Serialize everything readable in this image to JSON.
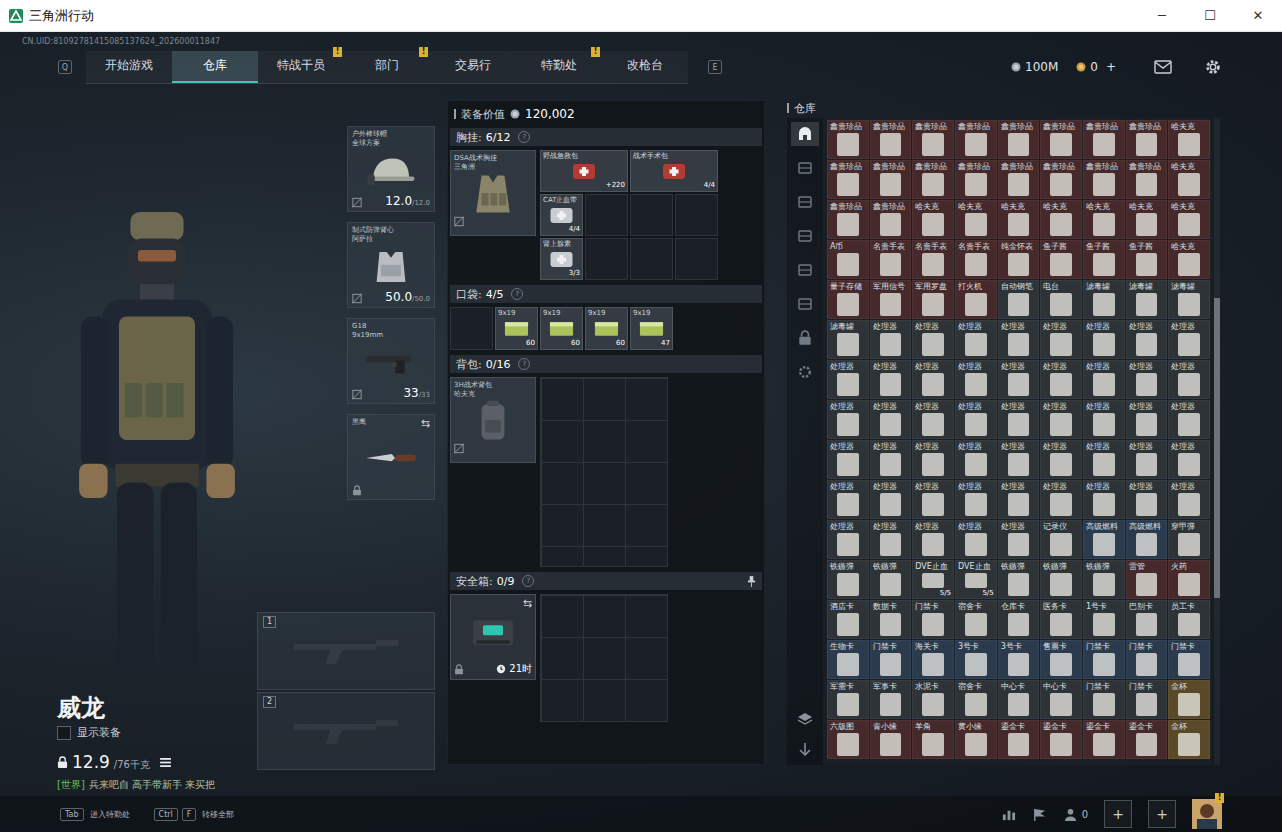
{
  "window": {
    "title": "三角洲行动",
    "controls": [
      "─",
      "☐",
      "✕"
    ]
  },
  "uid": "CN.UID:81092781415085137624_202600011847",
  "nav": {
    "left_key": "Q",
    "right_key": "E",
    "tabs": [
      {
        "label": "开始游戏",
        "selected": false,
        "badge": ""
      },
      {
        "label": "仓库",
        "selected": true,
        "badge": ""
      },
      {
        "label": "特战干员",
        "selected": false,
        "badge": "!"
      },
      {
        "label": "部门",
        "selected": false,
        "badge": "!"
      },
      {
        "label": "交易行",
        "selected": false,
        "badge": ""
      },
      {
        "label": "特勤处",
        "selected": false,
        "badge": "!"
      },
      {
        "label": "改枪台",
        "selected": false,
        "badge": ""
      }
    ]
  },
  "currency": {
    "coins": "100M",
    "tickets": "0",
    "add": "+"
  },
  "operator": {
    "name": "威龙",
    "show_gear": {
      "label": "显示装备",
      "checked": false
    },
    "weight": "12.9",
    "weight_max": "/76千克",
    "chat": {
      "channel": "[世界]",
      "message": "兵来吧自 高手带新手 来买把"
    }
  },
  "gear": [
    {
      "kind": "helmet",
      "name": "户外棒球帽",
      "sub": "全球方案",
      "value": "12.0",
      "max": "/12.0",
      "swap": ""
    },
    {
      "kind": "armor",
      "name": "制式防弹背心",
      "sub": "阿萨拉",
      "value": "50.0",
      "max": "/50.0",
      "swap": ""
    },
    {
      "kind": "pistol",
      "name": "G18",
      "sub": "9x19mm",
      "value": "33",
      "max": "/33",
      "swap": ""
    },
    {
      "kind": "knife",
      "name": "黑鹰",
      "sub": "",
      "value": "",
      "max": "",
      "swap": "⇆"
    }
  ],
  "weapon_slots": [
    "1",
    "2"
  ],
  "loadout": {
    "value_label": "装备价值",
    "value": "120,002",
    "chest": {
      "label": "胸挂:",
      "capacity": "6/12",
      "help": "?",
      "item": {
        "name": "DSA战术胸挂",
        "sub": "三角洲"
      },
      "slots": [
        {
          "kind": "wide",
          "name": "野战急救包",
          "count": "+220"
        },
        {
          "kind": "wide",
          "name": "战术手术包",
          "count": "4/4"
        },
        {
          "kind": "single",
          "name": "CAT止血带",
          "count": "4/4"
        },
        {
          "kind": "empty",
          "name": "",
          "count": ""
        },
        {
          "kind": "empty",
          "name": "",
          "count": ""
        },
        {
          "kind": "empty",
          "name": "",
          "count": ""
        },
        {
          "kind": "single",
          "name": "肾上腺素",
          "count": "3/3"
        },
        {
          "kind": "empty",
          "name": "",
          "count": ""
        },
        {
          "kind": "empty",
          "name": "",
          "count": ""
        },
        {
          "kind": "empty",
          "name": "",
          "count": ""
        }
      ]
    },
    "pockets": {
      "label": "口袋:",
      "capacity": "4/5",
      "help": "?",
      "slots": [
        {
          "kind": "empty",
          "name": "",
          "count": ""
        },
        {
          "kind": "ammo",
          "name": "9x19",
          "count": "60"
        },
        {
          "kind": "ammo",
          "name": "9x19",
          "count": "60"
        },
        {
          "kind": "ammo",
          "name": "9x19",
          "count": "60"
        },
        {
          "kind": "ammo",
          "name": "9x19",
          "count": "47"
        }
      ]
    },
    "backpack": {
      "label": "背包:",
      "capacity": "0/16",
      "help": "?",
      "item": {
        "name": "3H战术背包",
        "sub": "哈夫克"
      }
    },
    "safe": {
      "label": "安全箱:",
      "capacity": "0/9",
      "help": "?",
      "swap": "⇆",
      "timer": "21时"
    }
  },
  "warehouse": {
    "title": "仓库",
    "tabs": [
      {
        "selected": true
      },
      {
        "selected": false
      },
      {
        "selected": false
      },
      {
        "selected": false
      },
      {
        "selected": false
      },
      {
        "selected": false
      },
      {
        "selected": false
      },
      {
        "selected": false
      }
    ],
    "rows": [
      [
        {
          "name": "鑫贵珍品",
          "color": "#46292b",
          "count": ""
        },
        {
          "name": "鑫贵珍品",
          "color": "#46292b",
          "count": ""
        },
        {
          "name": "鑫贵珍品",
          "color": "#46292b",
          "count": ""
        },
        {
          "name": "鑫贵珍品",
          "color": "#46292b",
          "count": ""
        },
        {
          "name": "鑫贵珍品",
          "color": "#46292b",
          "count": ""
        },
        {
          "name": "鑫贵珍品",
          "color": "#46292b",
          "count": ""
        },
        {
          "name": "鑫贵珍品",
          "color": "#46292b",
          "count": ""
        },
        {
          "name": "鑫贵珍品",
          "color": "#46292b",
          "count": ""
        },
        {
          "name": "哈夫克",
          "color": "#46292b",
          "count": ""
        }
      ],
      [
        {
          "name": "鑫贵珍品",
          "color": "#46292b",
          "count": ""
        },
        {
          "name": "鑫贵珍品",
          "color": "#46292b",
          "count": ""
        },
        {
          "name": "鑫贵珍品",
          "color": "#46292b",
          "count": ""
        },
        {
          "name": "鑫贵珍品",
          "color": "#46292b",
          "count": ""
        },
        {
          "name": "鑫贵珍品",
          "color": "#46292b",
          "count": ""
        },
        {
          "name": "鑫贵珍品",
          "color": "#46292b",
          "count": ""
        },
        {
          "name": "鑫贵珍品",
          "color": "#46292b",
          "count": ""
        },
        {
          "name": "鑫贵珍品",
          "color": "#46292b",
          "count": ""
        },
        {
          "name": "哈夫克",
          "color": "#46292b",
          "count": ""
        }
      ],
      [
        {
          "name": "鑫贵珍品",
          "color": "#46292b",
          "count": ""
        },
        {
          "name": "鑫贵珍品",
          "color": "#46292b",
          "count": ""
        },
        {
          "name": "哈夫克",
          "color": "#46292b",
          "count": ""
        },
        {
          "name": "哈夫克",
          "color": "#46292b",
          "count": ""
        },
        {
          "name": "哈夫克",
          "color": "#46292b",
          "count": ""
        },
        {
          "name": "哈夫克",
          "color": "#46292b",
          "count": ""
        },
        {
          "name": "哈夫克",
          "color": "#46292b",
          "count": ""
        },
        {
          "name": "哈夫克",
          "color": "#46292b",
          "count": ""
        },
        {
          "name": "哈夫克",
          "color": "#46292b",
          "count": ""
        }
      ],
      [
        {
          "name": "A币",
          "color": "#46292b",
          "count": ""
        },
        {
          "name": "名贵手表",
          "color": "#46292b",
          "count": ""
        },
        {
          "name": "名贵手表",
          "color": "#46292b",
          "count": ""
        },
        {
          "name": "名贵手表",
          "color": "#46292b",
          "count": ""
        },
        {
          "name": "纯金怀表",
          "color": "#46292b",
          "count": ""
        },
        {
          "name": "鱼子酱",
          "color": "#46292b",
          "count": ""
        },
        {
          "name": "鱼子酱",
          "color": "#46292b",
          "count": ""
        },
        {
          "name": "鱼子酱",
          "color": "#46292b",
          "count": ""
        },
        {
          "name": "哈夫克",
          "color": "#46292b",
          "count": ""
        }
      ],
      [
        {
          "name": "量子存储",
          "color": "#46292b",
          "count": ""
        },
        {
          "name": "军用信号",
          "color": "#46292b",
          "count": ""
        },
        {
          "name": "军用罗盘",
          "color": "#46292b",
          "count": ""
        },
        {
          "name": "打火机",
          "color": "#46292b",
          "count": ""
        },
        {
          "name": "自动钢笔",
          "color": "#2e3338",
          "count": ""
        },
        {
          "name": "电台",
          "color": "#2e3338",
          "count": ""
        },
        {
          "name": "滤毒罐",
          "color": "#2e3338",
          "count": ""
        },
        {
          "name": "滤毒罐",
          "color": "#2e3338",
          "count": ""
        },
        {
          "name": "滤毒罐",
          "color": "#2e3338",
          "count": ""
        }
      ],
      [
        {
          "name": "滤毒罐",
          "color": "#2e3338",
          "count": ""
        },
        {
          "name": "处理器",
          "color": "#2e3338",
          "count": ""
        },
        {
          "name": "处理器",
          "color": "#2e3338",
          "count": ""
        },
        {
          "name": "处理器",
          "color": "#2e3338",
          "count": ""
        },
        {
          "name": "处理器",
          "color": "#2e3338",
          "count": ""
        },
        {
          "name": "处理器",
          "color": "#2e3338",
          "count": ""
        },
        {
          "name": "处理器",
          "color": "#2e3338",
          "count": ""
        },
        {
          "name": "处理器",
          "color": "#2e3338",
          "count": ""
        },
        {
          "name": "处理器",
          "color": "#2e3338",
          "count": ""
        }
      ],
      [
        {
          "name": "处理器",
          "color": "#2e3338",
          "count": ""
        },
        {
          "name": "处理器",
          "color": "#2e3338",
          "count": ""
        },
        {
          "name": "处理器",
          "color": "#2e3338",
          "count": ""
        },
        {
          "name": "处理器",
          "color": "#2e3338",
          "count": ""
        },
        {
          "name": "处理器",
          "color": "#2e3338",
          "count": ""
        },
        {
          "name": "处理器",
          "color": "#2e3338",
          "count": ""
        },
        {
          "name": "处理器",
          "color": "#2e3338",
          "count": ""
        },
        {
          "name": "处理器",
          "color": "#2e3338",
          "count": ""
        },
        {
          "name": "处理器",
          "color": "#2e3338",
          "count": ""
        }
      ],
      [
        {
          "name": "处理器",
          "color": "#2e3338",
          "count": ""
        },
        {
          "name": "处理器",
          "color": "#2e3338",
          "count": ""
        },
        {
          "name": "处理器",
          "color": "#2e3338",
          "count": ""
        },
        {
          "name": "处理器",
          "color": "#2e3338",
          "count": ""
        },
        {
          "name": "处理器",
          "color": "#2e3338",
          "count": ""
        },
        {
          "name": "处理器",
          "color": "#2e3338",
          "count": ""
        },
        {
          "name": "处理器",
          "color": "#2e3338",
          "count": ""
        },
        {
          "name": "处理器",
          "color": "#2e3338",
          "count": ""
        },
        {
          "name": "处理器",
          "color": "#2e3338",
          "count": ""
        }
      ],
      [
        {
          "name": "处理器",
          "color": "#2e3338",
          "count": ""
        },
        {
          "name": "处理器",
          "color": "#2e3338",
          "count": ""
        },
        {
          "name": "处理器",
          "color": "#2e3338",
          "count": ""
        },
        {
          "name": "处理器",
          "color": "#2e3338",
          "count": ""
        },
        {
          "name": "处理器",
          "color": "#2e3338",
          "count": ""
        },
        {
          "name": "处理器",
          "color": "#2e3338",
          "count": ""
        },
        {
          "name": "处理器",
          "color": "#2e3338",
          "count": ""
        },
        {
          "name": "处理器",
          "color": "#2e3338",
          "count": ""
        },
        {
          "name": "处理器",
          "color": "#2e3338",
          "count": ""
        }
      ],
      [
        {
          "name": "处理器",
          "color": "#2e3338",
          "count": ""
        },
        {
          "name": "处理器",
          "color": "#2e3338",
          "count": ""
        },
        {
          "name": "处理器",
          "color": "#2e3338",
          "count": ""
        },
        {
          "name": "处理器",
          "color": "#2e3338",
          "count": ""
        },
        {
          "name": "处理器",
          "color": "#2e3338",
          "count": ""
        },
        {
          "name": "处理器",
          "color": "#2e3338",
          "count": ""
        },
        {
          "name": "处理器",
          "color": "#2e3338",
          "count": ""
        },
        {
          "name": "处理器",
          "color": "#2e3338",
          "count": ""
        },
        {
          "name": "处理器",
          "color": "#2e3338",
          "count": ""
        }
      ],
      [
        {
          "name": "处理器",
          "color": "#2e3338",
          "count": ""
        },
        {
          "name": "处理器",
          "color": "#2e3338",
          "count": ""
        },
        {
          "name": "处理器",
          "color": "#2e3338",
          "count": ""
        },
        {
          "name": "处理器",
          "color": "#2e3338",
          "count": ""
        },
        {
          "name": "处理器",
          "color": "#2e3338",
          "count": ""
        },
        {
          "name": "记录仪",
          "color": "#2e3338",
          "count": ""
        },
        {
          "name": "高级燃料",
          "color": "#2c3a4e",
          "count": ""
        },
        {
          "name": "高级燃料",
          "color": "#2c3a4e",
          "count": ""
        },
        {
          "name": "穿甲弹",
          "color": "#2e3338",
          "count": ""
        }
      ],
      [
        {
          "name": "铁鏃弹",
          "color": "#2e3338",
          "count": ""
        },
        {
          "name": "铁鏃弹",
          "color": "#2e3338",
          "count": ""
        },
        {
          "name": "DVE止血",
          "color": "#2e3338",
          "count": "5/5"
        },
        {
          "name": "DVE止血",
          "color": "#2e3338",
          "count": "5/5"
        },
        {
          "name": "铁鏃弹",
          "color": "#2e3338",
          "count": ""
        },
        {
          "name": "铁鏃弹",
          "color": "#2e3338",
          "count": ""
        },
        {
          "name": "铁鏃弹",
          "color": "#2e3338",
          "count": ""
        },
        {
          "name": "雷管",
          "color": "#46292b",
          "count": ""
        },
        {
          "name": "火药",
          "color": "#46292b",
          "count": ""
        }
      ],
      [
        {
          "name": "酒店卡",
          "color": "#2e3338",
          "count": ""
        },
        {
          "name": "数据卡",
          "color": "#2e3338",
          "count": ""
        },
        {
          "name": "门禁卡",
          "color": "#2e3338",
          "count": ""
        },
        {
          "name": "宿舍卡",
          "color": "#2e3338",
          "count": ""
        },
        {
          "name": "仓库卡",
          "color": "#2e3338",
          "count": ""
        },
        {
          "name": "医务卡",
          "color": "#2e3338",
          "count": ""
        },
        {
          "name": "1号卡",
          "color": "#2e3338",
          "count": ""
        },
        {
          "name": "巴别卡",
          "color": "#2e3338",
          "count": ""
        },
        {
          "name": "员工卡",
          "color": "#2e3338",
          "count": ""
        }
      ],
      [
        {
          "name": "生物卡",
          "color": "#2c3a4e",
          "count": ""
        },
        {
          "name": "门禁卡",
          "color": "#2c3a4e",
          "count": ""
        },
        {
          "name": "海关卡",
          "color": "#2c3a4e",
          "count": ""
        },
        {
          "name": "3号卡",
          "color": "#2c3a4e",
          "count": ""
        },
        {
          "name": "3号卡",
          "color": "#2c3a4e",
          "count": ""
        },
        {
          "name": "售票卡",
          "color": "#2c3a4e",
          "count": ""
        },
        {
          "name": "门禁卡",
          "color": "#2c3a4e",
          "count": ""
        },
        {
          "name": "门禁卡",
          "color": "#2c3a4e",
          "count": ""
        },
        {
          "name": "门禁卡",
          "color": "#2c3a4e",
          "count": ""
        }
      ],
      [
        {
          "name": "军需卡",
          "color": "#2e3338",
          "count": ""
        },
        {
          "name": "军事卡",
          "color": "#2e3338",
          "count": ""
        },
        {
          "name": "水泥卡",
          "color": "#2e3338",
          "count": ""
        },
        {
          "name": "宿舍卡",
          "color": "#2e3338",
          "count": ""
        },
        {
          "name": "中心卡",
          "color": "#2e3338",
          "count": ""
        },
        {
          "name": "中心卡",
          "color": "#2e3338",
          "count": ""
        },
        {
          "name": "门禁卡",
          "color": "#2e3338",
          "count": ""
        },
        {
          "name": "门禁卡",
          "color": "#2e3338",
          "count": ""
        },
        {
          "name": "金杯",
          "color": "#5a4926",
          "count": ""
        }
      ],
      [
        {
          "name": "六版图",
          "color": "#46292b",
          "count": ""
        },
        {
          "name": "青小缘",
          "color": "#46292b",
          "count": ""
        },
        {
          "name": "羊角",
          "color": "#46292b",
          "count": ""
        },
        {
          "name": "黄小缘",
          "color": "#46292b",
          "count": ""
        },
        {
          "name": "鎏金卡",
          "color": "#46292b",
          "count": ""
        },
        {
          "name": "鎏金卡",
          "color": "#46292b",
          "count": ""
        },
        {
          "name": "鎏金卡",
          "color": "#46292b",
          "count": ""
        },
        {
          "name": "鎏金卡",
          "color": "#46292b",
          "count": ""
        },
        {
          "name": "金杯",
          "color": "#5a4926",
          "count": ""
        }
      ]
    ]
  },
  "footer": {
    "hotkeys": [
      {
        "keys": [
          "Tab"
        ],
        "label": "进入特勤处"
      },
      {
        "keys": [
          "Ctrl",
          "F"
        ],
        "label": "转移全部"
      }
    ],
    "friends": "0",
    "add_buttons": [
      "+",
      "+"
    ],
    "avatar_badge": "!"
  }
}
